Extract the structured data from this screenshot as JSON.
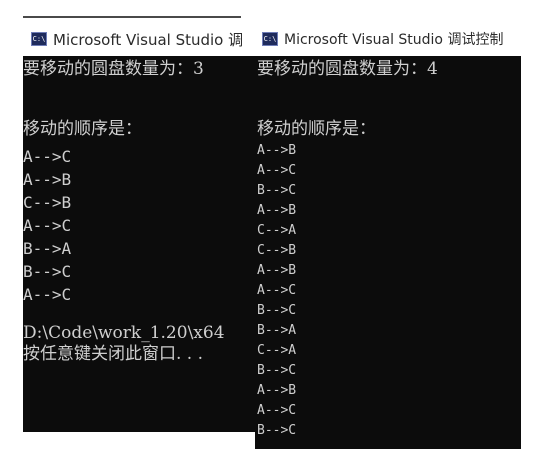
{
  "windows": [
    {
      "title": "Microsoft Visual Studio 调",
      "icon": "console-app-icon",
      "count_line": "要移动的圆盘数量为：3",
      "order_header": "移动的顺序是：",
      "moves": [
        "A-->C",
        "A-->B",
        "C-->B",
        "A-->C",
        "B-->A",
        "B-->C",
        "A-->C"
      ],
      "path_line": "D:\\Code\\work_1.20\\x64",
      "close_line": "按任意键关闭此窗口. . ."
    },
    {
      "title": "Microsoft Visual Studio 调试控制",
      "icon": "console-app-icon",
      "count_line": "要移动的圆盘数量为：4",
      "order_header": "移动的顺序是：",
      "moves": [
        "A-->B",
        "A-->C",
        "B-->C",
        "A-->B",
        "C-->A",
        "C-->B",
        "A-->B",
        "A-->C",
        "B-->C",
        "B-->A",
        "C-->A",
        "B-->C",
        "A-->B",
        "A-->C",
        "B-->C"
      ]
    }
  ],
  "colors": {
    "console_bg": "#0c0c0c",
    "console_text": "#cfcfcf",
    "title_text": "#2b2b2b"
  }
}
